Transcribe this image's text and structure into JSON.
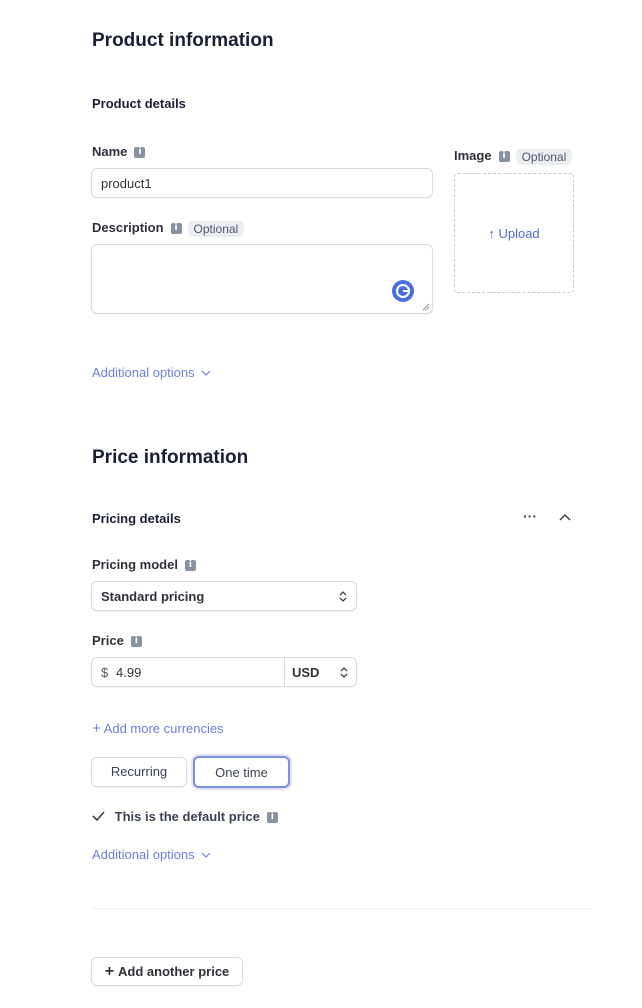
{
  "product_section": {
    "title": "Product information",
    "details_heading": "Product details",
    "name_label": "Name",
    "name_value": "product1",
    "description_label": "Description",
    "description_badge": "Optional",
    "image_label": "Image",
    "image_badge": "Optional",
    "upload_label": "Upload",
    "additional_options": "Additional options"
  },
  "price_section": {
    "title": "Price information",
    "details_heading": "Pricing details",
    "pricing_model_label": "Pricing model",
    "pricing_model_value": "Standard pricing",
    "price_label": "Price",
    "currency_symbol": "$",
    "price_value": "4.99",
    "currency_value": "USD",
    "add_currencies": "Add more currencies",
    "recurring_label": "Recurring",
    "one_time_label": "One time",
    "default_price_text": "This is the default price",
    "additional_options": "Additional options",
    "add_another_price": "Add another price"
  },
  "icons": {
    "info": "info-icon",
    "upload": "arrow-up-icon",
    "chevron": "chevron-down-icon",
    "more": "ellipsis-icon",
    "collapse": "chevron-up-icon",
    "sort": "sort-icon",
    "check": "check-icon",
    "plus": "plus-icon",
    "grammarly": "grammarly-icon"
  },
  "colors": {
    "link": "#5469d4",
    "selected_border": "#5469d4",
    "text": "#1a1f36"
  }
}
